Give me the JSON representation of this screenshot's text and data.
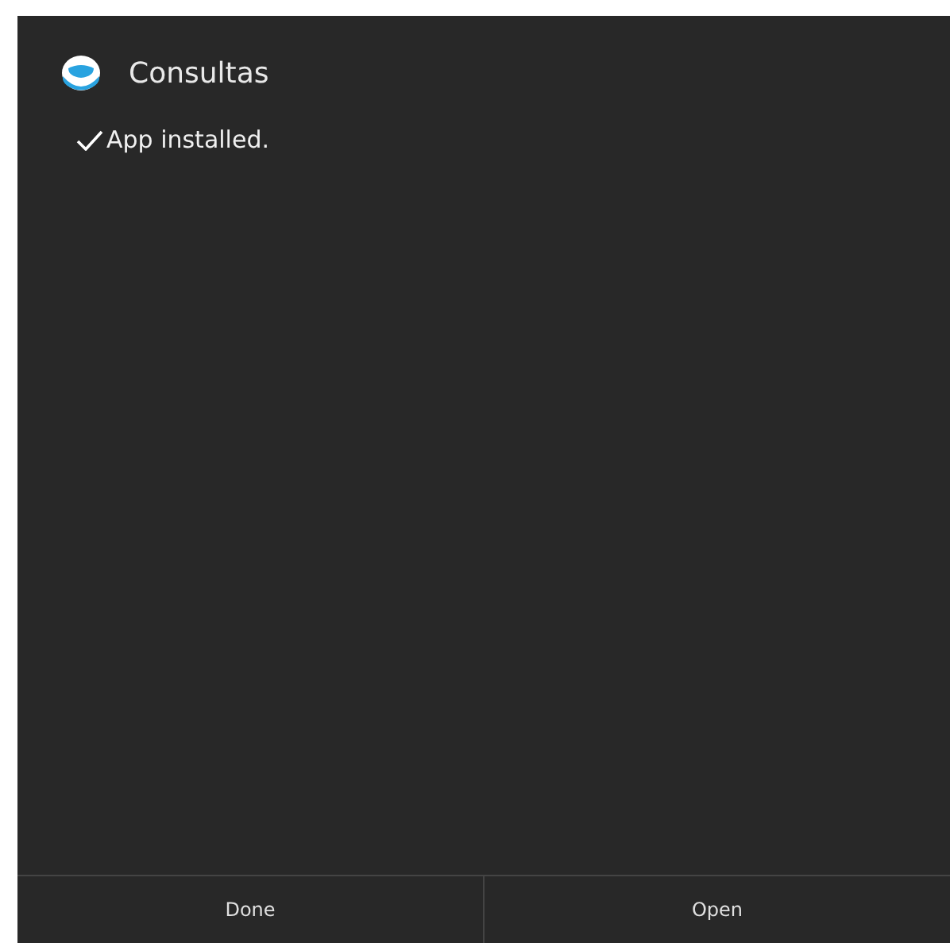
{
  "app": {
    "name": "Consultas"
  },
  "status": {
    "message": "App installed."
  },
  "buttons": [
    {
      "label": "Done"
    },
    {
      "label": "Open"
    }
  ]
}
